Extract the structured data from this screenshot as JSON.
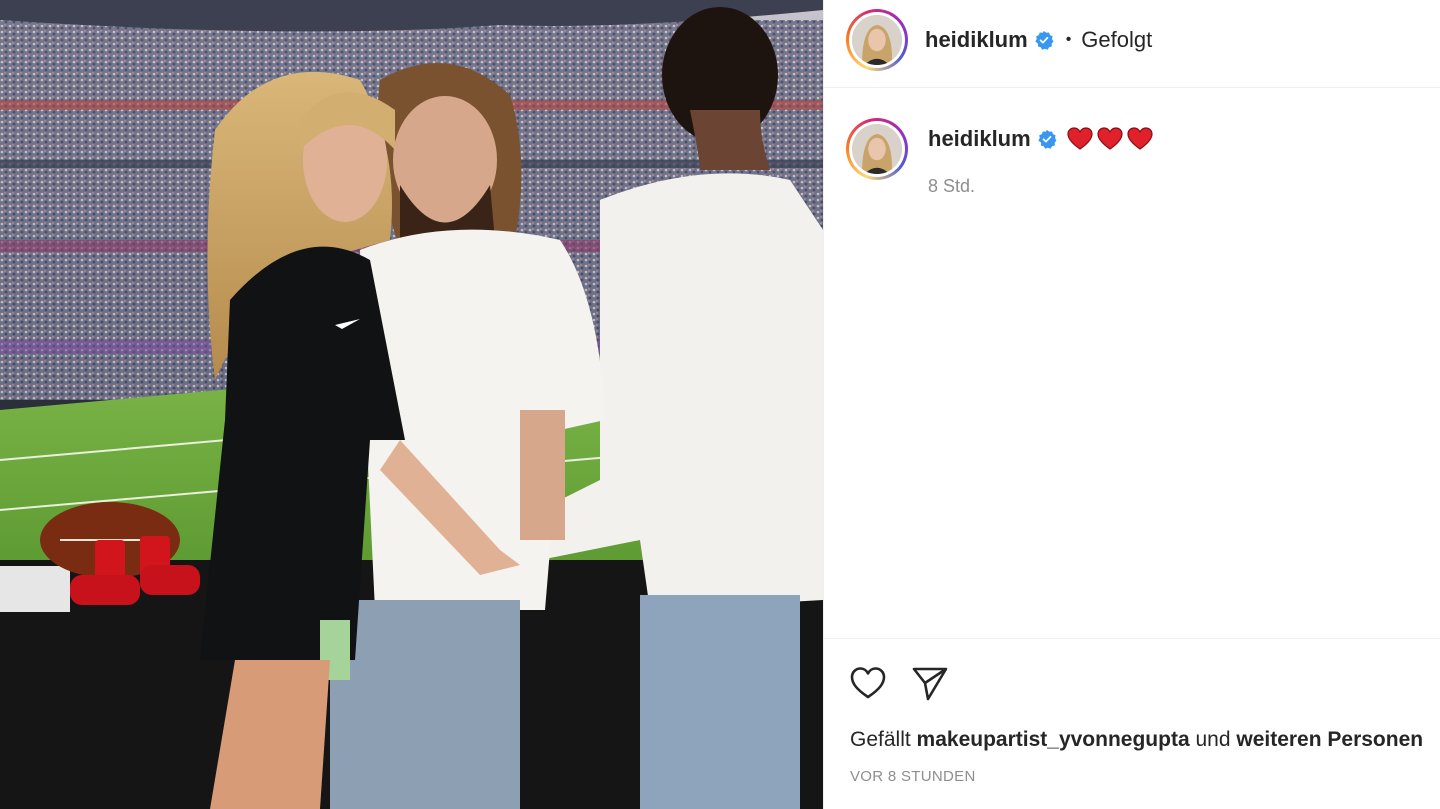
{
  "post": {
    "username": "heidiklum",
    "follow_status": "Gefolgt",
    "caption_user": "heidiklum",
    "caption_icons": [
      "heart-emoji",
      "heart-emoji",
      "heart-emoji"
    ],
    "time_ago": "8 Std.",
    "likes_prefix": "Gefällt",
    "likes_user": "makeupartist_yvonnegupta",
    "likes_middle": "und",
    "likes_suffix": "weiteren Personen",
    "post_time": "VOR 8 STUNDEN"
  },
  "colors": {
    "verified_blue": "#3897f0",
    "heart_red": "#e0202a",
    "secondary_text": "#8e8e8e"
  }
}
